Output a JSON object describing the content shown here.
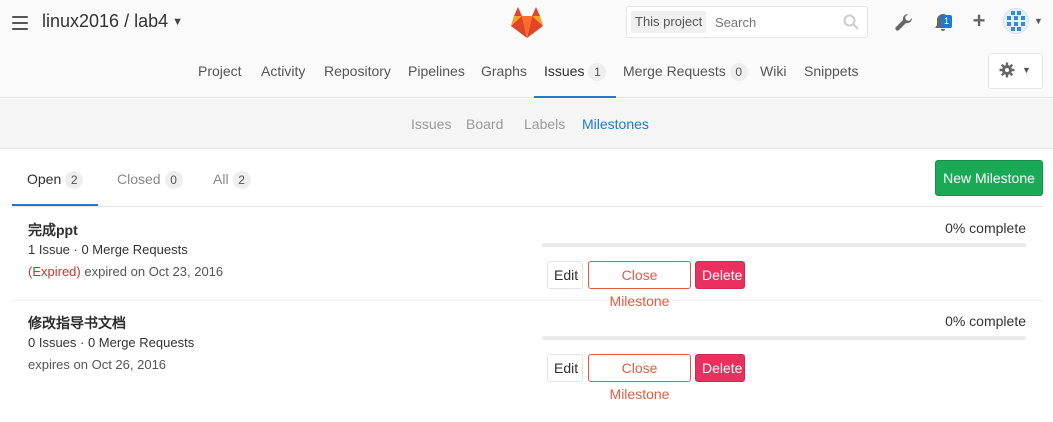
{
  "header": {
    "project_path": "linux2016 / lab4",
    "search_scope": "This project",
    "search_placeholder": "Search",
    "notification_count": "1"
  },
  "nav": {
    "items": [
      {
        "label": "Project"
      },
      {
        "label": "Activity"
      },
      {
        "label": "Repository"
      },
      {
        "label": "Pipelines"
      },
      {
        "label": "Graphs"
      },
      {
        "label": "Issues",
        "count": "1"
      },
      {
        "label": "Merge Requests",
        "count": "0"
      },
      {
        "label": "Wiki"
      },
      {
        "label": "Snippets"
      }
    ]
  },
  "subnav": {
    "items": [
      {
        "label": "Issues"
      },
      {
        "label": "Board"
      },
      {
        "label": "Labels"
      },
      {
        "label": "Milestones"
      }
    ]
  },
  "tabs": [
    {
      "label": "Open",
      "count": "2"
    },
    {
      "label": "Closed",
      "count": "0"
    },
    {
      "label": "All",
      "count": "2"
    }
  ],
  "new_milestone_label": "New Milestone",
  "milestones": [
    {
      "title": "完成ppt",
      "counts": "1 Issue · 0 Merge Requests",
      "expired_tag": "(Expired)",
      "date_text": "expired on Oct 23, 2016",
      "complete_text": "0% complete",
      "progress": 0,
      "edit_label": "Edit",
      "close_label": "Close Milestone",
      "delete_label": "Delete"
    },
    {
      "title": "修改指导书文档",
      "counts": "0 Issues · 0 Merge Requests",
      "date_text": "expires on Oct 26, 2016",
      "complete_text": "0% complete",
      "progress": 0,
      "edit_label": "Edit",
      "close_label": "Close Milestone",
      "delete_label": "Delete"
    }
  ],
  "colors": {
    "accent": "#1f78d1",
    "success": "#1aaa55",
    "danger": "#e9305f",
    "warning_outline": "#e05d44"
  },
  "icons": {
    "menu": "hamburger-icon",
    "logo": "gitlab-fox-logo",
    "search": "search-icon",
    "admin": "wrench-icon",
    "notifications": "bell-icon",
    "new": "plus-icon",
    "settings": "gear-icon"
  }
}
